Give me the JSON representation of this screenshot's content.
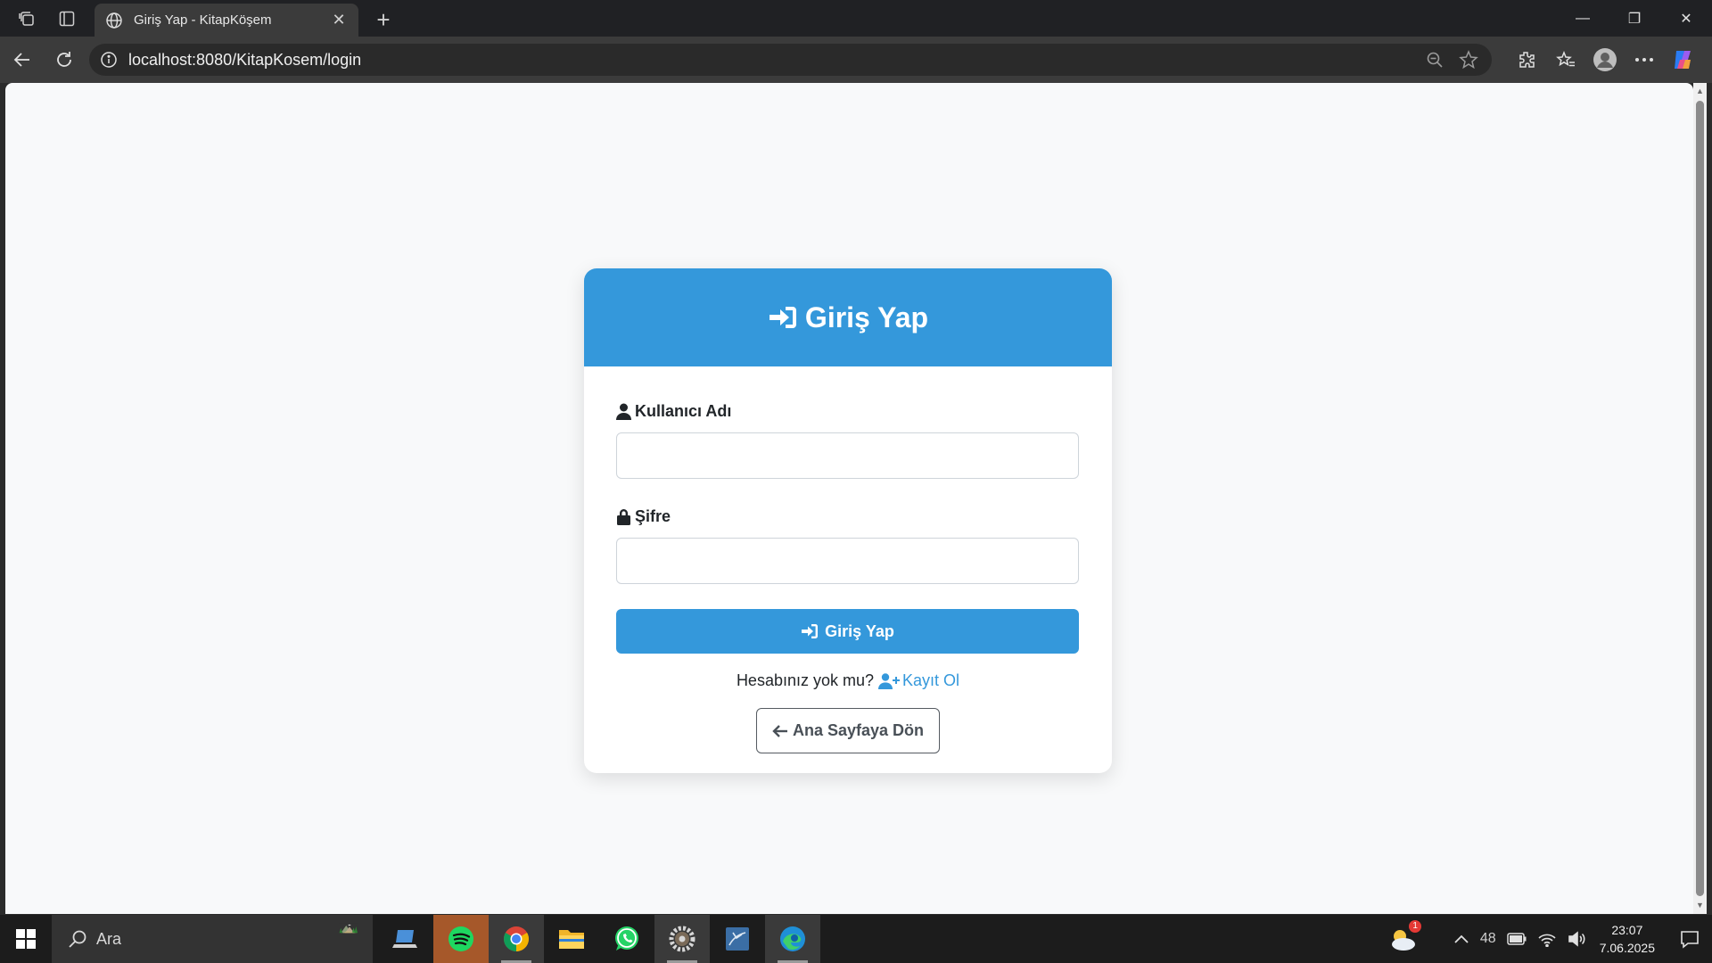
{
  "browser": {
    "tab_title": "Giriş Yap - KitapKöşem",
    "tab_close": "✕",
    "new_tab": "+",
    "url": "localhost:8080/KitapKosem/login",
    "window_controls": {
      "minimize": "—",
      "restore": "❐",
      "close": "✕"
    }
  },
  "page": {
    "background": "#f8f9fa",
    "accent_color": "#3498db",
    "card": {
      "header_title": "Giriş Yap",
      "username_label": "Kullanıcı Adı",
      "username_value": "",
      "password_label": "Şifre",
      "password_value": "",
      "submit_label": "Giriş Yap",
      "register_prompt": "Hesabınız yok mu?",
      "register_link": "Kayıt Ol",
      "back_label": "Ana Sayfaya Dön"
    }
  },
  "taskbar": {
    "search_placeholder": "Ara",
    "weather_badge": "1",
    "tray_temp": "48",
    "time": "23:07",
    "date": "7.06.2025"
  },
  "icons": {
    "tab_favicon": "globe-icon",
    "header": "sign-in-icon",
    "username": "user-icon",
    "password": "lock-icon",
    "register": "user-plus-icon",
    "back": "arrow-left-icon"
  }
}
